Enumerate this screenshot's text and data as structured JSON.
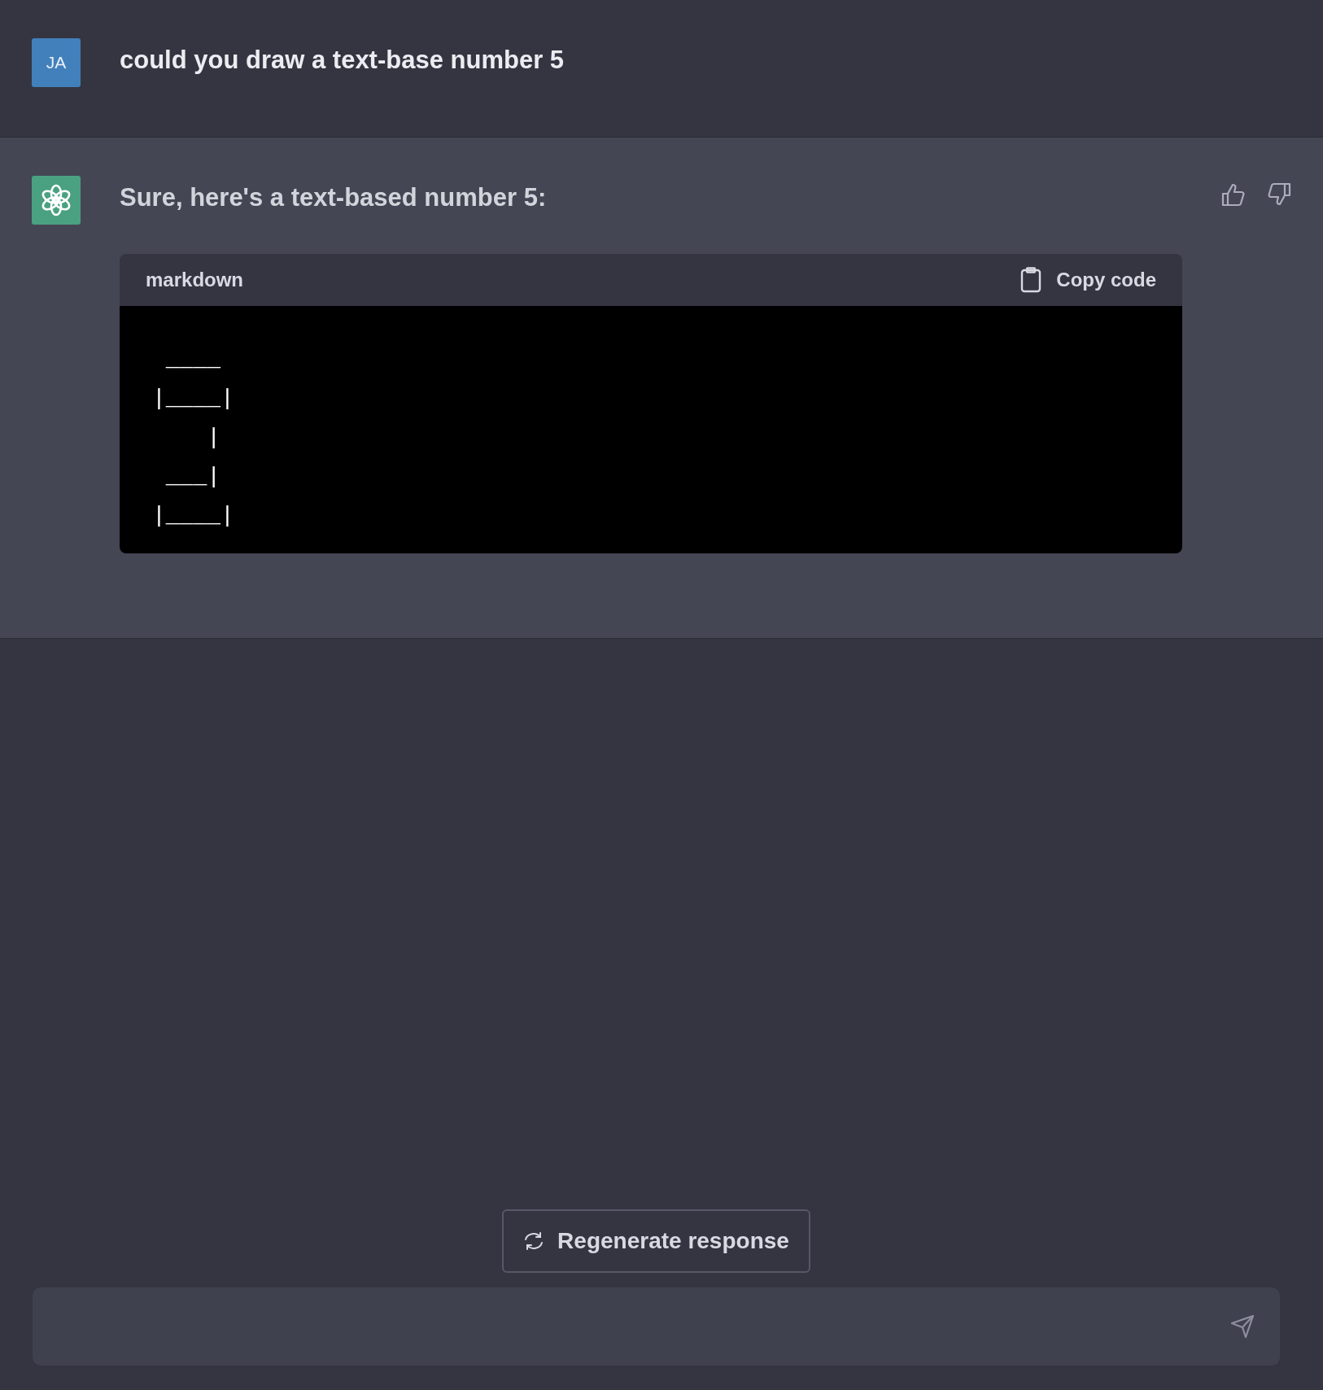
{
  "messages": [
    {
      "kind": "user",
      "avatar": "JA",
      "text": "could you draw a text-base number 5"
    },
    {
      "kind": "assistant",
      "text": "Sure, here's a text-based number 5:",
      "code_block": {
        "language": "markdown",
        "copy_label": "Copy code",
        "lines": [
          " ____",
          "|____|",
          "    |",
          " ___|",
          "|____|"
        ]
      }
    }
  ],
  "regenerate_button": {
    "label": "Regenerate response"
  }
}
